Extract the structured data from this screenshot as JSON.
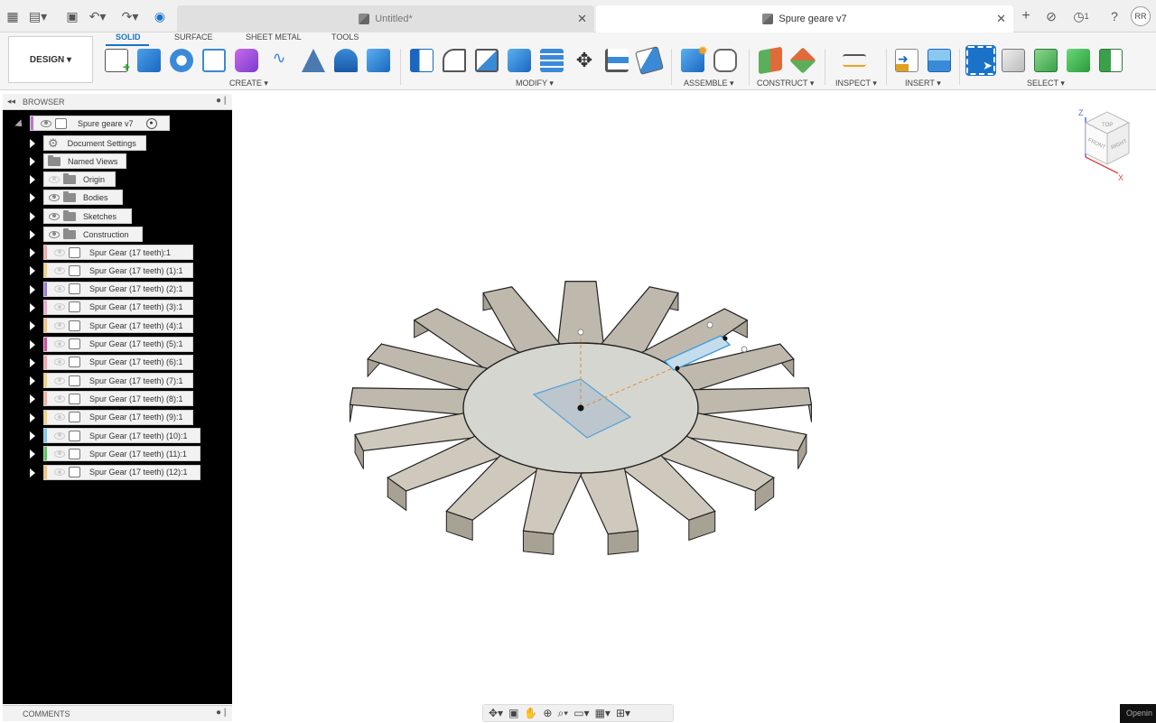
{
  "titlebar": {
    "tabs": [
      {
        "label": "Untitled*",
        "active": false
      },
      {
        "label": "Spure geare v7",
        "active": true
      }
    ],
    "job_count": "1",
    "user_initials": "RR"
  },
  "toolbar": {
    "workspace": "DESIGN",
    "workspace_tabs": [
      "SOLID",
      "SURFACE",
      "SHEET METAL",
      "TOOLS"
    ],
    "groups": [
      "CREATE",
      "MODIFY",
      "ASSEMBLE",
      "CONSTRUCT",
      "INSPECT",
      "INSERT",
      "SELECT"
    ]
  },
  "browser": {
    "title": "BROWSER",
    "root": "Spure geare v7",
    "folders": [
      "Document Settings",
      "Named Views",
      "Origin",
      "Bodies",
      "Sketches",
      "Construction"
    ],
    "components": [
      {
        "label": "Spur Gear (17 teeth):1",
        "color": "#f4a6a6"
      },
      {
        "label": "Spur Gear (17 teeth) (1):1",
        "color": "#f6d27a"
      },
      {
        "label": "Spur Gear (17 teeth) (2):1",
        "color": "#9a7ad8"
      },
      {
        "label": "Spur Gear (17 teeth) (3):1",
        "color": "#f4a6c8"
      },
      {
        "label": "Spur Gear (17 teeth) (4):1",
        "color": "#f6c27a"
      },
      {
        "label": "Spur Gear (17 teeth) (5):1",
        "color": "#d84aa0"
      },
      {
        "label": "Spur Gear (17 teeth) (6):1",
        "color": "#f4a6a6"
      },
      {
        "label": "Spur Gear (17 teeth) (7):1",
        "color": "#f6d27a"
      },
      {
        "label": "Spur Gear (17 teeth) (8):1",
        "color": "#f4b0a0"
      },
      {
        "label": "Spur Gear (17 teeth) (9):1",
        "color": "#f6d27a"
      },
      {
        "label": "Spur Gear (17 teeth) (10):1",
        "color": "#7ac8f6"
      },
      {
        "label": "Spur Gear (17 teeth) (11):1",
        "color": "#5ac85a"
      },
      {
        "label": "Spur Gear (17 teeth) (12):1",
        "color": "#f6c27a"
      }
    ]
  },
  "comments": {
    "title": "COMMENTS"
  },
  "viewcube": {
    "top": "TOP",
    "front": "FRONT",
    "right": "RIGHT",
    "axis_z": "Z",
    "axis_x": "X"
  },
  "status": {
    "text": "Openin"
  },
  "colors": {
    "accent": "#1a73c8",
    "gear": "#d8d3c8",
    "panel_bg": "#000000"
  }
}
